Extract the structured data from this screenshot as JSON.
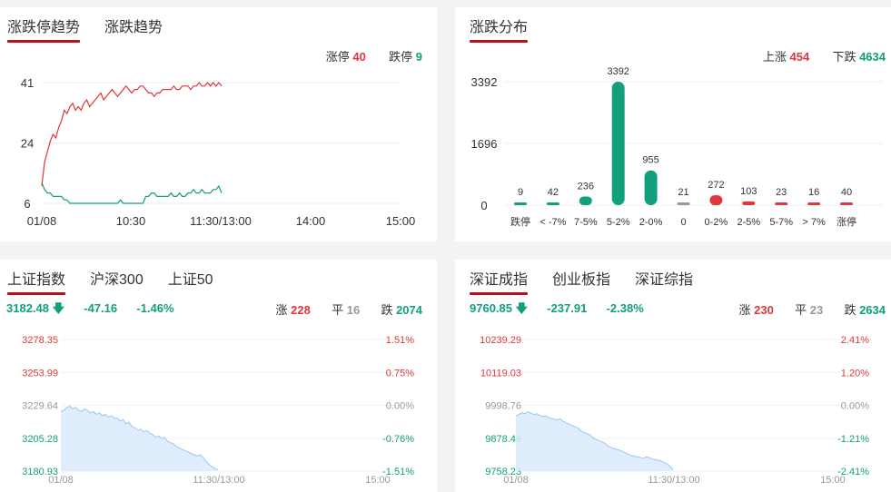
{
  "colors": {
    "up": "#e0373c",
    "down": "#12a07c",
    "accent": "#b1121f",
    "flat": "#999999"
  },
  "panel_trend": {
    "tabs": [
      {
        "label": "涨跌停趋势",
        "active": true
      },
      {
        "label": "涨跌趋势",
        "active": false
      }
    ],
    "limit_up_label": "涨停",
    "limit_up_value": "40",
    "limit_down_label": "跌停",
    "limit_down_value": "9",
    "chart_data": {
      "type": "line",
      "x_ticks": [
        "01/08",
        "10:30",
        "11:30/13:00",
        "14:00",
        "15:00"
      ],
      "y_ticks": [
        "41",
        "24",
        "6"
      ],
      "ylim": [
        6,
        41
      ],
      "series": [
        {
          "name": "涨停",
          "color": "#e0373c",
          "values": [
            11,
            18,
            21,
            24,
            26,
            25,
            28,
            30,
            33,
            32,
            34,
            35,
            33,
            34,
            33,
            35,
            36,
            34,
            35,
            36,
            37,
            38,
            36,
            37,
            38,
            39,
            38,
            37,
            38,
            39,
            40,
            39,
            38,
            39,
            39,
            40,
            40,
            39,
            38,
            38,
            37,
            38,
            38,
            39,
            39,
            39,
            39,
            40,
            39,
            39,
            40,
            40,
            40,
            39,
            40,
            40,
            41,
            40,
            40,
            41,
            40,
            41,
            40,
            41,
            40
          ]
        },
        {
          "name": "跌停",
          "color": "#12a07c",
          "values": [
            12,
            10,
            9,
            9,
            8,
            8,
            8,
            8,
            7,
            7,
            6,
            6,
            6,
            6,
            6,
            6,
            6,
            6,
            6,
            6,
            6,
            6,
            6,
            6,
            6,
            6,
            6,
            6,
            7,
            6,
            6,
            6,
            6,
            6,
            6,
            6,
            6,
            8,
            8,
            9,
            9,
            8,
            8,
            8,
            8,
            8,
            9,
            8,
            8,
            9,
            8,
            8,
            9,
            9,
            10,
            9,
            9,
            10,
            9,
            9,
            9,
            10,
            10,
            11,
            9
          ]
        }
      ]
    }
  },
  "panel_dist": {
    "tabs": [
      {
        "label": "涨跌分布",
        "active": true
      }
    ],
    "up_label": "上涨",
    "up_value": "454",
    "down_label": "下跌",
    "down_value": "4634",
    "chart_data": {
      "type": "bar",
      "categories": [
        "跌停",
        "< -7%",
        "7-5%",
        "5-2%",
        "2-0%",
        "0",
        "0-2%",
        "2-5%",
        "5-7%",
        "> 7%",
        "涨停"
      ],
      "values": [
        9,
        42,
        236,
        3392,
        955,
        21,
        272,
        103,
        23,
        16,
        40
      ],
      "colors": [
        "#12a07c",
        "#12a07c",
        "#12a07c",
        "#12a07c",
        "#12a07c",
        "#999999",
        "#e0373c",
        "#e0373c",
        "#e0373c",
        "#e0373c",
        "#e0373c"
      ],
      "y_ticks": [
        "3392",
        "1696",
        "0"
      ],
      "ylim": [
        0,
        3392
      ]
    }
  },
  "panel_sh": {
    "tabs": [
      {
        "label": "上证指数",
        "active": true
      },
      {
        "label": "沪深300",
        "active": false
      },
      {
        "label": "上证50",
        "active": false
      }
    ],
    "price": "3182.48",
    "arrow": "🡇",
    "change": "-47.16",
    "pct": "-1.46%",
    "up_label": "涨",
    "up_value": "228",
    "flat_label": "平",
    "flat_value": "16",
    "down_label": "跌",
    "down_value": "2074",
    "chart_data": {
      "type": "area",
      "left_ticks": [
        "3278.35",
        "3253.99",
        "3229.64",
        "3205.28",
        "3180.93"
      ],
      "right_ticks": [
        "1.51%",
        "0.75%",
        "0.00%",
        "-0.76%",
        "-1.51%"
      ],
      "x_ticks": [
        "01/08",
        "11:30/13:00",
        "15:00"
      ],
      "ylim": [
        3180.93,
        3278.35
      ],
      "values": [
        3225,
        3226,
        3228,
        3229,
        3227,
        3228,
        3226,
        3225,
        3227,
        3226,
        3224,
        3225,
        3223,
        3224,
        3222,
        3223,
        3221,
        3222,
        3220,
        3220,
        3218,
        3219,
        3216,
        3217,
        3214,
        3213,
        3211,
        3212,
        3210,
        3211,
        3209,
        3208,
        3206,
        3207,
        3205,
        3206,
        3203,
        3202,
        3201,
        3199,
        3198,
        3197,
        3196,
        3195,
        3194,
        3193,
        3192,
        3193,
        3191,
        3188,
        3186,
        3184,
        3183,
        3182
      ]
    }
  },
  "panel_sz": {
    "tabs": [
      {
        "label": "深证成指",
        "active": true
      },
      {
        "label": "创业板指",
        "active": false
      },
      {
        "label": "深证综指",
        "active": false
      }
    ],
    "price": "9760.85",
    "arrow": "🡇",
    "change": "-237.91",
    "pct": "-2.38%",
    "up_label": "涨",
    "up_value": "230",
    "flat_label": "平",
    "flat_value": "23",
    "down_label": "跌",
    "down_value": "2634",
    "chart_data": {
      "type": "area",
      "left_ticks": [
        "10239.29",
        "10119.03",
        "9998.76",
        "9878.49",
        "9758.23"
      ],
      "right_ticks": [
        "2.41%",
        "1.20%",
        "0.00%",
        "-1.21%",
        "-2.41%"
      ],
      "x_ticks": [
        "01/08",
        "11:30/13:00",
        "15:00"
      ],
      "ylim": [
        9758.23,
        10239.29
      ],
      "values": [
        9960,
        9965,
        9972,
        9968,
        9975,
        9970,
        9965,
        9968,
        9962,
        9958,
        9960,
        9955,
        9950,
        9948,
        9945,
        9950,
        9940,
        9935,
        9930,
        9925,
        9920,
        9915,
        9905,
        9900,
        9895,
        9890,
        9880,
        9875,
        9870,
        9865,
        9860,
        9850,
        9845,
        9840,
        9838,
        9835,
        9830,
        9825,
        9820,
        9815,
        9812,
        9810,
        9808,
        9805,
        9810,
        9808,
        9802,
        9800,
        9798,
        9795,
        9790,
        9785,
        9775,
        9765
      ]
    }
  }
}
